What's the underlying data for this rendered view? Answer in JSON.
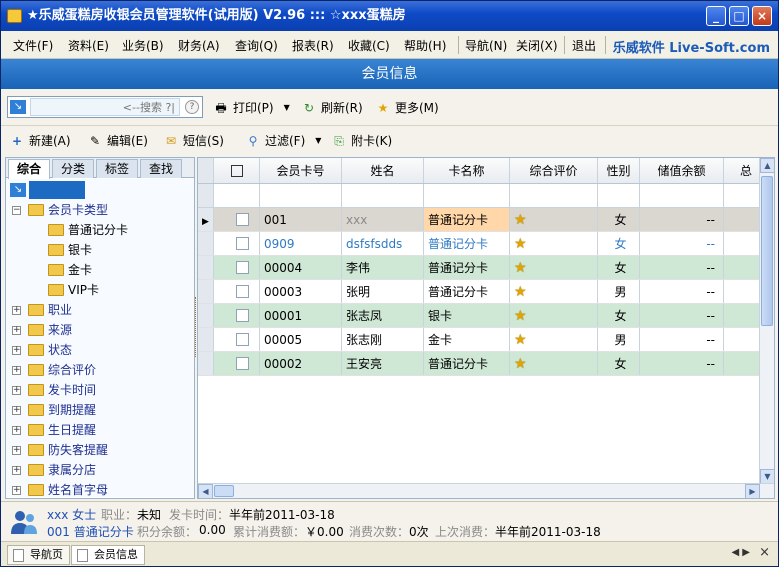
{
  "window": {
    "title": "★乐威蛋糕房收银会员管理软件(试用版) V2.96  :::  ☆xxx蛋糕房",
    "minimize_glyph": "_",
    "maximize_glyph": "□",
    "close_glyph": "×"
  },
  "menu": {
    "items": [
      "文件(F)",
      "资料(E)",
      "业务(B)",
      "财务(A)",
      "查询(Q)",
      "报表(R)",
      "收藏(C)",
      "帮助(H)",
      "导航(N)",
      "关闭(X)",
      "退出"
    ],
    "brand": "乐威软件 Live-Soft.com"
  },
  "header": {
    "title": "会员信息"
  },
  "toolbar1": {
    "search_placeholder": "<--搜索 ?|",
    "print": "打印(P)",
    "refresh": "刷新(R)",
    "more": "更多(M)"
  },
  "toolbar2": {
    "new": "新建(A)",
    "edit": "编辑(E)",
    "sms": "短信(S)",
    "filter": "过滤(F)",
    "card": "附卡(K)"
  },
  "left_tabs": [
    "综合",
    "分类",
    "标签",
    "查找"
  ],
  "tree": {
    "card_type_group": "会员卡类型",
    "card_types": [
      "普通记分卡",
      "银卡",
      "金卡",
      "VIP卡"
    ],
    "groups": [
      "职业",
      "来源",
      "状态",
      "综合评价",
      "发卡时间",
      "到期提醒",
      "生日提醒",
      "防失客提醒",
      "隶属分店",
      "姓名首字母"
    ]
  },
  "grid": {
    "columns": [
      "",
      "会员卡号",
      "姓名",
      "卡名称",
      "综合评价",
      "性别",
      "储值余额",
      "总"
    ],
    "rows": [
      {
        "card_no": "001",
        "name": "xxx",
        "card_name": "普通记分卡",
        "gender": "女",
        "balance": "--"
      },
      {
        "card_no": "0909",
        "name": "dsfsfsdds",
        "card_name": "普通记分卡",
        "gender": "女",
        "balance": "--"
      },
      {
        "card_no": "00004",
        "name": "李伟",
        "card_name": "普通记分卡",
        "gender": "女",
        "balance": "--"
      },
      {
        "card_no": "00003",
        "name": "张明",
        "card_name": "普通记分卡",
        "gender": "男",
        "balance": "--"
      },
      {
        "card_no": "00001",
        "name": "张志凤",
        "card_name": "银卡",
        "gender": "女",
        "balance": "--"
      },
      {
        "card_no": "00005",
        "name": "张志刚",
        "card_name": "金卡",
        "gender": "男",
        "balance": "--"
      },
      {
        "card_no": "00002",
        "name": "王安亮",
        "card_name": "普通记分卡",
        "gender": "女",
        "balance": "--"
      }
    ]
  },
  "footer": {
    "name": "xxx 女士",
    "job_label": "职业：",
    "job": "未知",
    "issue_label": "发卡时间：",
    "issue": "半年前2011-03-18",
    "card_line": "001 普通记分卡",
    "points_label": "积分余额：",
    "points": "0.00",
    "spend_label": "累计消费额：",
    "spend": "￥0.00",
    "count_label": "消费次数：",
    "count": "0次",
    "last_label": "上次消费：",
    "last": "半年前2011-03-18"
  },
  "statusbar": {
    "tabs": [
      "导航页",
      "会员信息"
    ]
  },
  "colors": {
    "header_blue": "#1963b8",
    "selection": "#1c6ac2",
    "tree_text": "#1f2f8f"
  }
}
